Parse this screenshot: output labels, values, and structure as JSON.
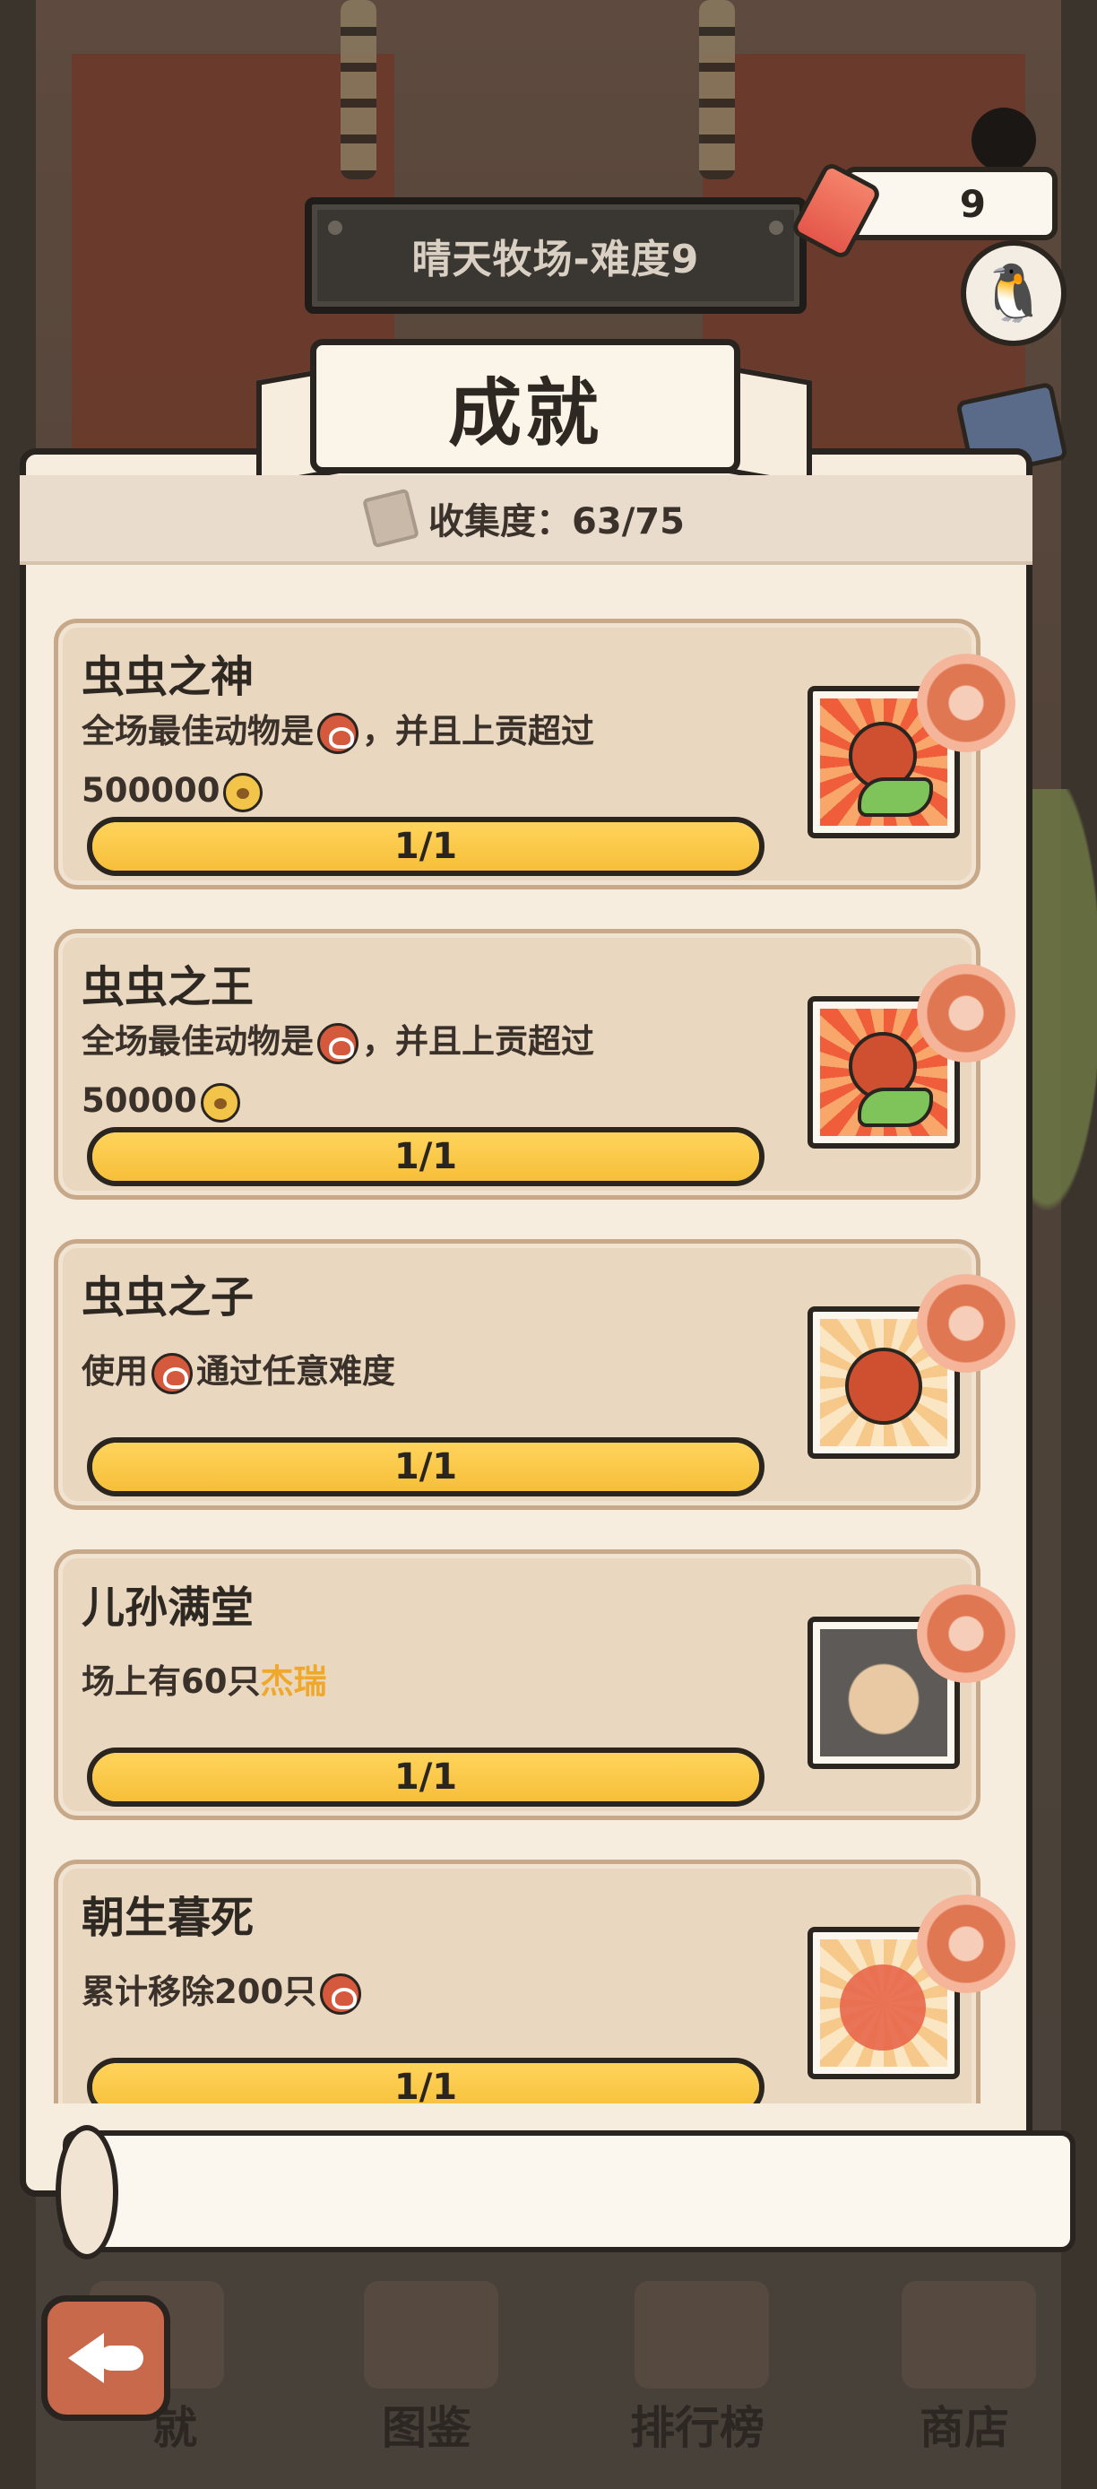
{
  "top_bar": {
    "level_label": "晴天牧场-难度9",
    "ticket_count": "9",
    "icons": [
      "gear-icon",
      "ticket-icon",
      "penguin-avatar-icon",
      "mail-icon"
    ]
  },
  "panel": {
    "title": "成就",
    "collection_label": "收集度：63/75"
  },
  "achievements": [
    {
      "title": "虫虫之神",
      "desc_line1_before": "全场最佳动物是",
      "desc_line1_after": "，并且上贡超过",
      "desc_line2": "500000",
      "progress_text": "1/1",
      "progress": 1.0,
      "badge_icon": "bug-god-badge-icon"
    },
    {
      "title": "虫虫之王",
      "desc_line1_before": "全场最佳动物是",
      "desc_line1_after": "，并且上贡超过",
      "desc_line2": "50000",
      "progress_text": "1/1",
      "progress": 1.0,
      "badge_icon": "bug-king-badge-icon"
    },
    {
      "title": "虫虫之子",
      "desc_before": "使用",
      "desc_after": "通过任意难度",
      "progress_text": "1/1",
      "progress": 1.0,
      "badge_icon": "bug-child-badge-icon"
    },
    {
      "title": "儿孙满堂",
      "desc_before": "场上有60只",
      "desc_highlight": "杰瑞",
      "progress_text": "1/1",
      "progress": 1.0,
      "badge_icon": "hamster-badge-icon"
    },
    {
      "title": "朝生暮死",
      "desc_before": "累计移除200只",
      "progress_text": "1/1",
      "progress": 1.0,
      "badge_icon": "bug-removal-badge-icon"
    }
  ],
  "bottom_nav": {
    "back_icon": "back-arrow-icon",
    "items": [
      {
        "label": "图鉴"
      },
      {
        "label": "排行榜"
      },
      {
        "label": "商店"
      }
    ],
    "partial_label": "就"
  },
  "colors": {
    "progress_fill": "#f6bf39",
    "highlight_text": "#f0a82a",
    "panel_bg": "#f7eddf",
    "card_bg": "#ead7c0"
  }
}
